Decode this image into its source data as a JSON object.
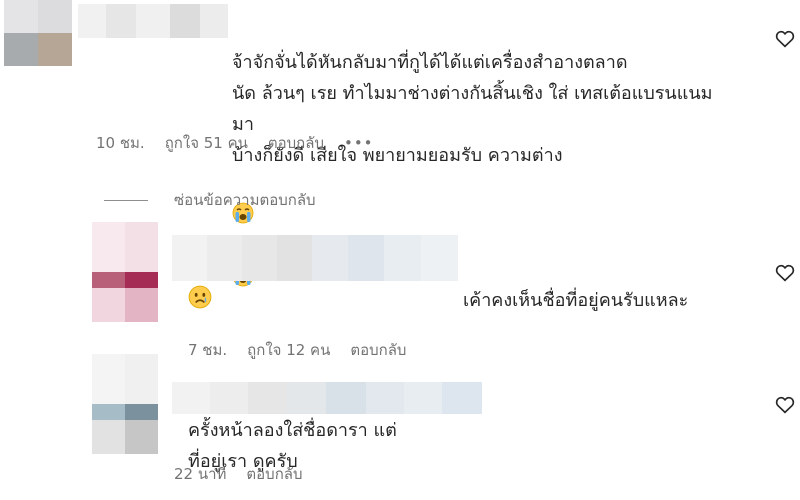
{
  "comments": [
    {
      "text": "จ้าจักจั่นได้หันกลับมาที่กูได้ได้แต่เครื่องสำอางตลาด\nนัด ล้วนๆ เรย ทำไมมาช่างต่างกันสิ้นเชิง ใส่ เทสเต้อแบรนแนมมา\nบ้างก็ยังดี เสียใจ พยายามยอมรับ ความต่าง",
      "emoji": "loudly-crying-face",
      "time": "10 ชม.",
      "likes": "ถูกใจ 51 คน",
      "reply": "ตอบกลับ",
      "more": "•••"
    }
  ],
  "hide_replies_label": "ซ่อนข้อความตอบกลับ",
  "replies": [
    {
      "text": "เค้าคงเห็นชื่อที่อยู่คนรับแหละ",
      "emoji": "sad-face",
      "time": "7 ชม.",
      "likes": "ถูกใจ 12 คน",
      "reply": "ตอบกลับ"
    },
    {
      "text": "ครั้งหน้าลองใส่ชื่อดารา แต่\nที่อยู่เรา ดูครับ",
      "time": "22 นาที",
      "reply": "ตอบกลับ"
    }
  ],
  "colors": {
    "text": "#262626",
    "secondary": "#737373"
  }
}
